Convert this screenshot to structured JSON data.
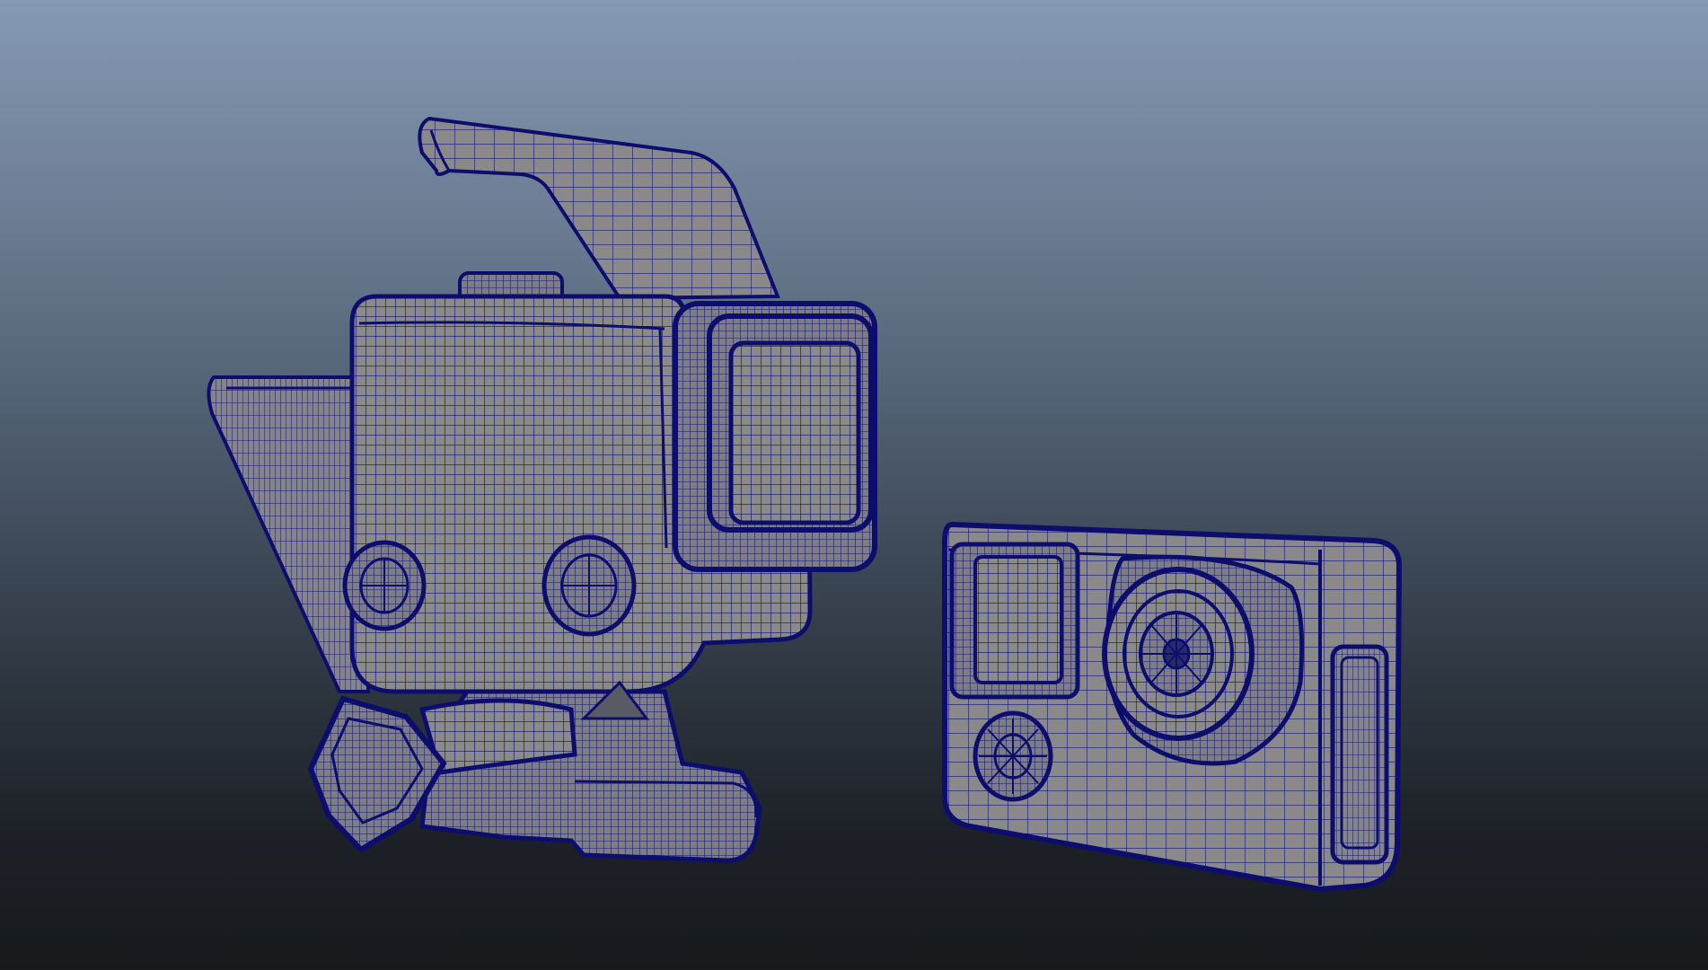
{
  "viewport": {
    "background_top": "#8599b2",
    "background_bottom": "#17191c"
  },
  "models": [
    {
      "name": "camera-housing-with-mount",
      "surface_color": "#8b8b8b",
      "wire_color": "#10107a"
    },
    {
      "name": "action-camera-body",
      "surface_color": "#8b8b8b",
      "wire_color": "#10107a"
    }
  ]
}
